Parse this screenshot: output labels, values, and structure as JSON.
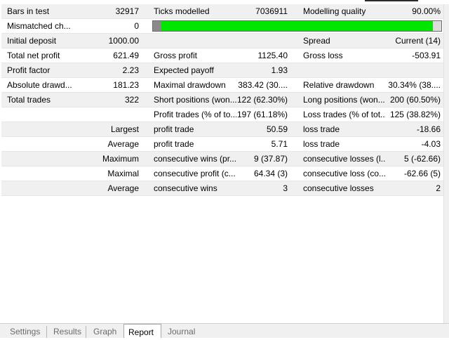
{
  "colors": {
    "progress_fill": "#00e600",
    "row_alt": "#f0f0f0"
  },
  "rows": [
    {
      "c1": "Bars in test",
      "c2": "32917",
      "c3": "Ticks modelled",
      "c4": "7036911",
      "c5": "Modelling quality",
      "c6": "90.00%"
    },
    {
      "c1": "Mismatched ch...",
      "c2": "0",
      "progress": 0.97
    },
    {
      "c1": "Initial deposit",
      "c2": "1000.00",
      "c3": "",
      "c4": "",
      "c5": "Spread",
      "c6": "Current (14)"
    },
    {
      "c1": "Total net profit",
      "c2": "621.49",
      "c3": "Gross profit",
      "c4": "1125.40",
      "c5": "Gross loss",
      "c6": "-503.91"
    },
    {
      "c1": "Profit factor",
      "c2": "2.23",
      "c3": "Expected payoff",
      "c4": "1.93",
      "c5": "",
      "c6": ""
    },
    {
      "c1": "Absolute drawd...",
      "c2": "181.23",
      "c3": "Maximal drawdown",
      "c4": "383.42 (30....",
      "c5": "Relative drawdown",
      "c6": "30.34% (38...."
    },
    {
      "c1": "Total trades",
      "c2": "322",
      "c3": "Short positions (won...",
      "c4": "122 (62.30%)",
      "c5": "Long positions (won...",
      "c6": "200 (60.50%)"
    },
    {
      "c1": "",
      "c2": "",
      "c3": "Profit trades (% of to...",
      "c4": "197 (61.18%)",
      "c5": "Loss trades (% of tot...",
      "c6": "125 (38.82%)"
    },
    {
      "c1": "",
      "c2": "Largest",
      "c3": "profit trade",
      "c4": "50.59",
      "c5": "loss trade",
      "c6": "-18.66"
    },
    {
      "c1": "",
      "c2": "Average",
      "c3": "profit trade",
      "c4": "5.71",
      "c5": "loss trade",
      "c6": "-4.03"
    },
    {
      "c1": "",
      "c2": "Maximum",
      "c3": "consecutive wins (pr...",
      "c4": "9 (37.87)",
      "c5": "consecutive losses (l...",
      "c6": "5 (-62.66)"
    },
    {
      "c1": "",
      "c2": "Maximal",
      "c3": "consecutive profit (c...",
      "c4": "64.34 (3)",
      "c5": "consecutive loss (co...",
      "c6": "-62.66 (5)"
    },
    {
      "c1": "",
      "c2": "Average",
      "c3": "consecutive wins",
      "c4": "3",
      "c5": "consecutive losses",
      "c6": "2"
    }
  ],
  "tabs": [
    "Settings",
    "Results",
    "Graph",
    "Report",
    "Journal"
  ],
  "active_tab": "Report"
}
